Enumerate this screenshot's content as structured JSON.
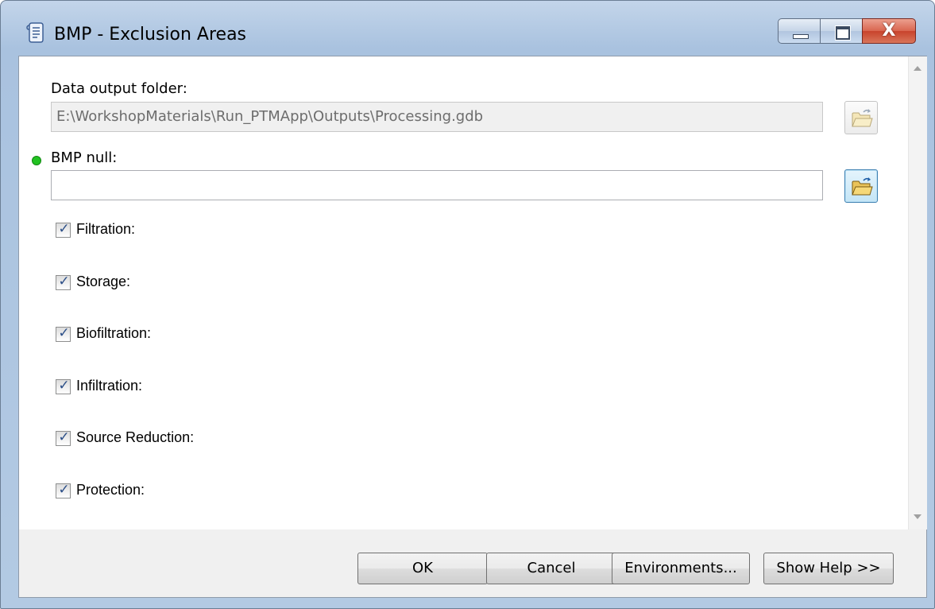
{
  "window": {
    "title": "BMP - Exclusion Areas",
    "icon": "toolbox-script-icon"
  },
  "caption_buttons": {
    "minimize": "minimize-icon",
    "maximize": "maximize-icon",
    "close_glyph": "X"
  },
  "params": {
    "output_folder": {
      "label": "Data output folder:",
      "value": "E:\\WorkshopMaterials\\Run_PTMApp\\Outputs\\Processing.gdb",
      "enabled": false
    },
    "bmp_null": {
      "label": "BMP null:",
      "value": "",
      "required": true,
      "required_color": "#22c222"
    },
    "checkboxes": [
      {
        "label": "Filtration:",
        "checked": true
      },
      {
        "label": "Storage:",
        "checked": true
      },
      {
        "label": "Biofiltration:",
        "checked": true
      },
      {
        "label": "Infiltration:",
        "checked": true
      },
      {
        "label": "Source Reduction:",
        "checked": true
      },
      {
        "label": "Protection:",
        "checked": true
      }
    ],
    "check_glyph": "✓"
  },
  "buttons": {
    "ok": "OK",
    "cancel": "Cancel",
    "environments": "Environments...",
    "show_help": "Show Help >>"
  }
}
